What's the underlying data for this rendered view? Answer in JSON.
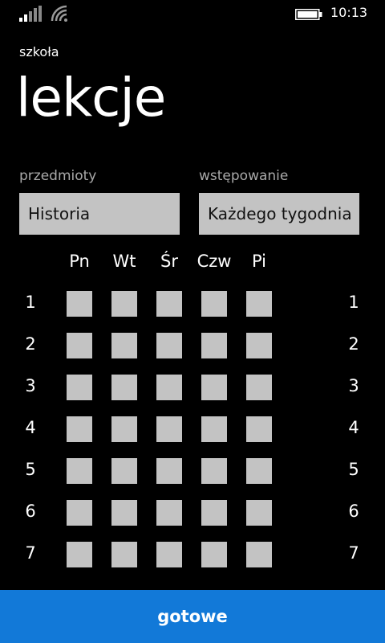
{
  "status": {
    "time": "10:13"
  },
  "app": {
    "title": "szkoła"
  },
  "page": {
    "title": "lekcje"
  },
  "subject": {
    "label": "przedmioty",
    "value": "Historia"
  },
  "recurrence": {
    "label": "wstępowanie",
    "value": "Każdego tygodnia"
  },
  "schedule": {
    "days": [
      "Pn",
      "Wt",
      "Śr",
      "Czw",
      "Pi"
    ],
    "lessons": [
      "1",
      "2",
      "3",
      "4",
      "5",
      "6",
      "7"
    ]
  },
  "done_button": {
    "label": "gotowe"
  },
  "colors": {
    "accent": "#1279d8",
    "cell": "#c3c3c3",
    "label": "#a9a9a9",
    "background": "#000000"
  }
}
